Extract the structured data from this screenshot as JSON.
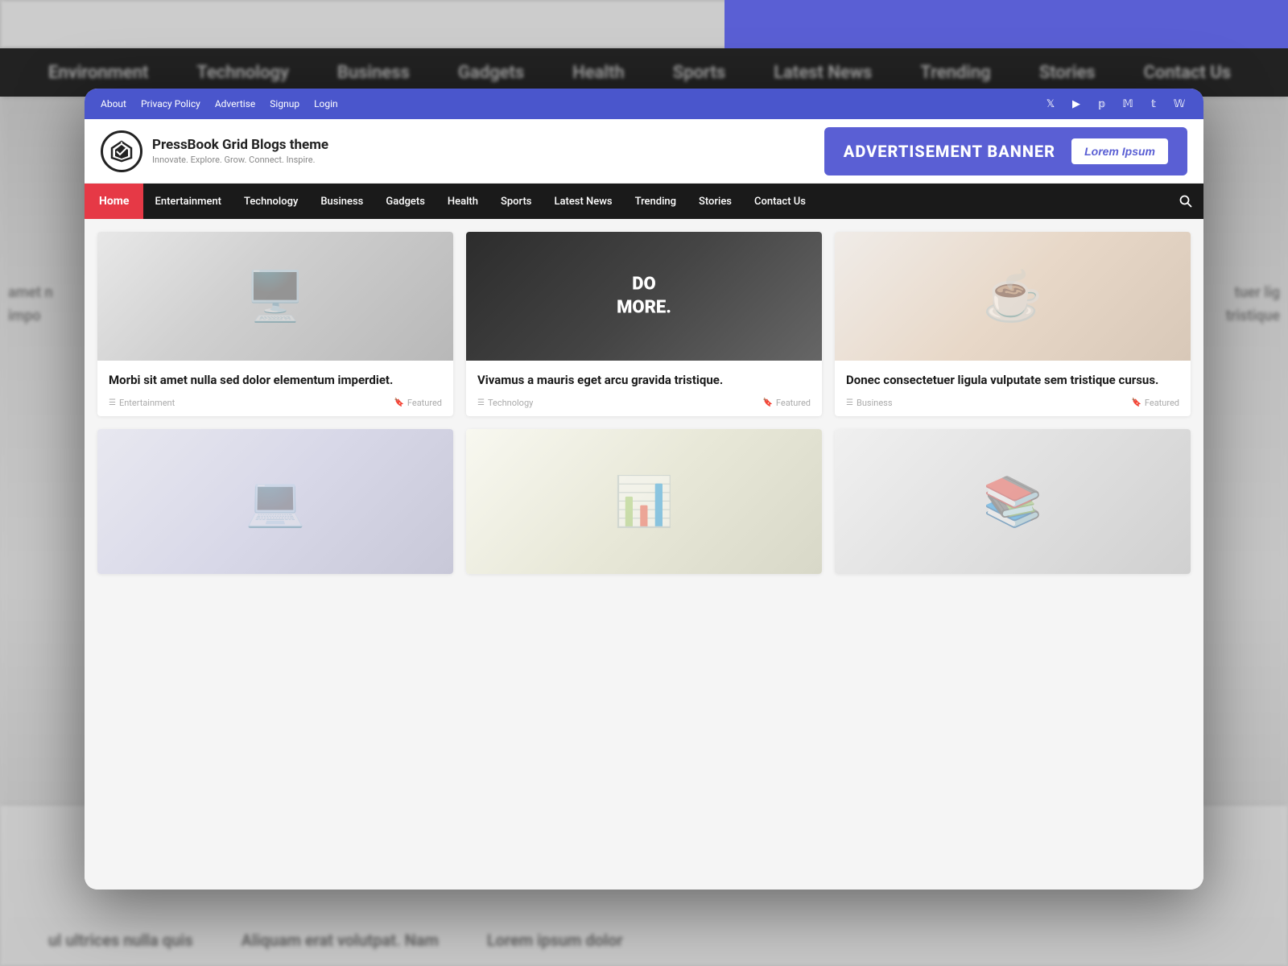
{
  "background": {
    "nav_items": [
      "Environment",
      "Technology",
      "Business",
      "Gadgets",
      "Health",
      "Sports",
      "Latest News",
      "Trending",
      "Stories",
      "Contact Us"
    ],
    "bottom_texts": [
      "ul ultrices nulla quis",
      "Aliquam erat volutpat. Nam",
      "Lorem ipsum dolor"
    ]
  },
  "topbar": {
    "links": [
      "About",
      "Privacy Policy",
      "Advertise",
      "Signup",
      "Login"
    ],
    "socials": [
      "𝕏",
      "▶",
      "𝕡",
      "𝕄",
      "𝕥",
      "𝕎"
    ]
  },
  "header": {
    "logo_symbol": "⌁",
    "site_name": "PressBook Grid Blogs theme",
    "tagline": "Innovate. Explore. Grow. Connect. Inspire.",
    "ad_text": "ADVERTISEMENT BANNER",
    "ad_btn": "Lorem Ipsum"
  },
  "nav": {
    "home": "Home",
    "items": [
      "Entertainment",
      "Technology",
      "Business",
      "Gadgets",
      "Health",
      "Sports",
      "Latest News",
      "Trending",
      "Stories",
      "Contact Us"
    ]
  },
  "cards": [
    {
      "id": 1,
      "title": "Morbi sit amet nulla sed dolor elementum imperdiet.",
      "category": "Entertainment",
      "tag": "Featured",
      "img_class": "img-desk1"
    },
    {
      "id": 2,
      "title": "Vivamus a mauris eget arcu gravida tristique.",
      "category": "Technology",
      "tag": "Featured",
      "img_class": "img-desk2"
    },
    {
      "id": 3,
      "title": "Donec consectetuer ligula vulputate sem tristique cursus.",
      "category": "Business",
      "tag": "Featured",
      "img_class": "img-coffee"
    },
    {
      "id": 4,
      "title": "",
      "category": "",
      "tag": "",
      "img_class": "img-workspace1"
    },
    {
      "id": 5,
      "title": "",
      "category": "",
      "tag": "",
      "img_class": "img-monitor"
    },
    {
      "id": 6,
      "title": "",
      "category": "",
      "tag": "",
      "img_class": "img-books"
    }
  ],
  "colors": {
    "nav_bg": "#1a1a1a",
    "home_btn": "#e63946",
    "topbar_bg": "#4a56cc",
    "ad_bg": "#5a5fd4"
  }
}
